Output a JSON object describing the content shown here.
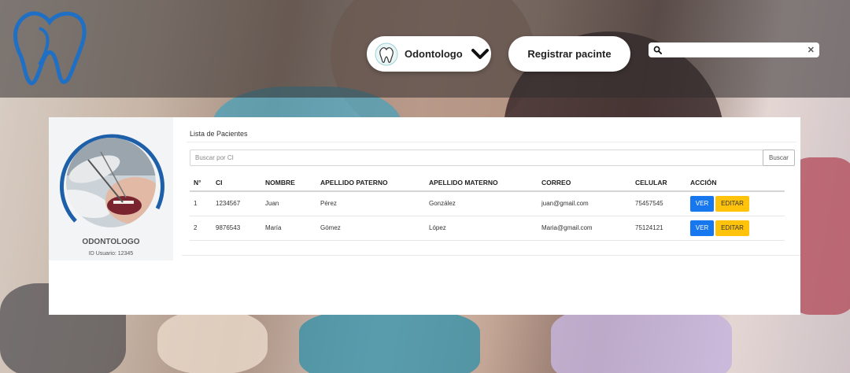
{
  "colors": {
    "brand_blue": "#1f6fc4",
    "ver_button": "#1677ee",
    "editar_button": "#ffc30b"
  },
  "header": {
    "logo_icon": "tooth-logo-icon",
    "role_dropdown": {
      "label": "Odontologo",
      "icon": "tooth-icon",
      "chevron": "chevron-down-icon"
    },
    "register_button": "Registrar pacinte",
    "search": {
      "value": "",
      "placeholder": "",
      "icon": "search-icon",
      "clear_icon": "✕"
    }
  },
  "profile": {
    "role": "ODONTOLOGO",
    "user_id": "ID Usuario: 12345"
  },
  "patients": {
    "title": "Lista de Pacientes",
    "search_placeholder": "Buscar por CI",
    "search_button": "Buscar",
    "columns": [
      "N°",
      "CI",
      "NOMBRE",
      "APELLIDO PATERNO",
      "APELLIDO MATERNO",
      "CORREO",
      "CELULAR",
      "ACCIÓN"
    ],
    "rows": [
      {
        "n": "1",
        "ci": "1234567",
        "nombre": "Juan",
        "paterno": "Pérez",
        "materno": "González",
        "correo": "juan@gmail.com",
        "celular": "75457545",
        "ver": "VER",
        "editar": "EDITAR"
      },
      {
        "n": "2",
        "ci": "9876543",
        "nombre": "María",
        "paterno": "Gómez",
        "materno": "López",
        "correo": "Maria@gmail.com",
        "celular": "75124121",
        "ver": "VER",
        "editar": "EDITAR"
      }
    ]
  }
}
